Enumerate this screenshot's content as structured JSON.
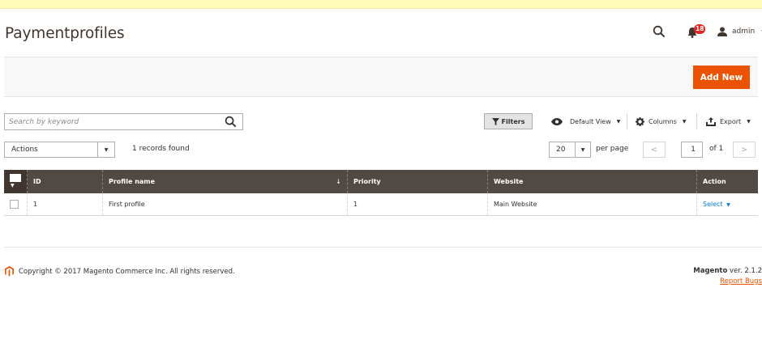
{
  "header": {
    "title": "Paymentprofiles",
    "notifications_count": "18",
    "admin_user": "admin"
  },
  "action_bar": {
    "add_new_label": "Add New"
  },
  "toolbar": {
    "search_placeholder": "Search by keyword",
    "filters_label": "Filters",
    "default_view_label": "Default View",
    "columns_label": "Columns",
    "export_label": "Export",
    "actions_label": "Actions",
    "records_found": "1 records found",
    "per_page_value": "20",
    "per_page_label": "per page",
    "current_page": "1",
    "page_total": "of 1"
  },
  "grid": {
    "columns": [
      "ID",
      "Profile name",
      "Priority",
      "Website",
      "Action"
    ],
    "sort_indicator": "↓",
    "rows": [
      {
        "id": "1",
        "profile_name": "First profile",
        "priority": "1",
        "website": "Main Website",
        "action": "Select"
      }
    ]
  },
  "footer": {
    "copyright": "Copyright © 2017 Magento Commerce Inc. All rights reserved.",
    "brand": "Magento",
    "version": " ver. 2.1.2",
    "report_bugs": "Report Bugs"
  },
  "colors": {
    "accent": "#eb5202",
    "grid_header": "#514943",
    "link": "#007bdb",
    "badge": "#e22626",
    "message_bar": "#fffbbb"
  },
  "icons": [
    "search-icon",
    "bell-icon",
    "user-icon",
    "filter-icon",
    "eye-icon",
    "gear-icon",
    "export-icon",
    "magento-logo-icon"
  ]
}
